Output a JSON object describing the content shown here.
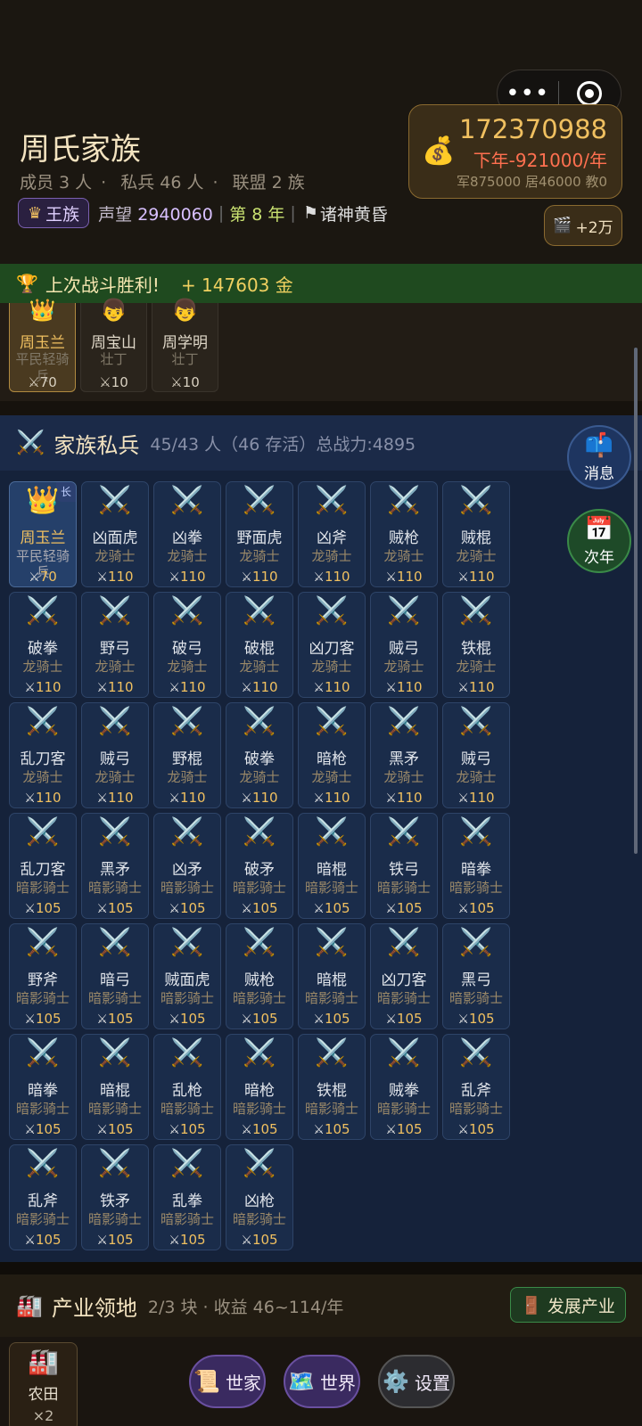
{
  "header": {
    "family_name": "周氏家族",
    "members": "成员 3 人",
    "private_soldiers": "私兵 46 人",
    "alliance": "联盟 2 族",
    "dot": "·",
    "rank_badge": "王族",
    "prestige_label": "声望",
    "prestige_value": "2940060",
    "year": "第 8 年",
    "era": "诸神黄昏"
  },
  "money": {
    "amount": "172370988",
    "income": "下年-921000/年",
    "detail": "军875000 居46000 教0"
  },
  "ad_button": {
    "label": "+2万"
  },
  "victory": {
    "text": "上次战斗胜利!",
    "gold": "+ 147603 金"
  },
  "members": [
    {
      "name": "周玉兰",
      "rank": "平民轻骑兵",
      "power": "70",
      "icon": "crown"
    },
    {
      "name": "周宝山",
      "rank": "壮丁",
      "power": "10",
      "icon": "face"
    },
    {
      "name": "周学明",
      "rank": "壮丁",
      "power": "10",
      "icon": "face"
    }
  ],
  "army": {
    "title": "家族私兵",
    "stats": "45/43 人（46 存活）总战力:4895",
    "leader_badge": "长",
    "soldiers": [
      {
        "name": "周玉兰",
        "rank": "平民轻骑兵",
        "power": "70"
      },
      {
        "name": "凶面虎",
        "rank": "龙骑士",
        "power": "110"
      },
      {
        "name": "凶拳",
        "rank": "龙骑士",
        "power": "110"
      },
      {
        "name": "野面虎",
        "rank": "龙骑士",
        "power": "110"
      },
      {
        "name": "凶斧",
        "rank": "龙骑士",
        "power": "110"
      },
      {
        "name": "贼枪",
        "rank": "龙骑士",
        "power": "110"
      },
      {
        "name": "贼棍",
        "rank": "龙骑士",
        "power": "110"
      },
      {
        "name": "破拳",
        "rank": "龙骑士",
        "power": "110"
      },
      {
        "name": "野弓",
        "rank": "龙骑士",
        "power": "110"
      },
      {
        "name": "破弓",
        "rank": "龙骑士",
        "power": "110"
      },
      {
        "name": "破棍",
        "rank": "龙骑士",
        "power": "110"
      },
      {
        "name": "凶刀客",
        "rank": "龙骑士",
        "power": "110"
      },
      {
        "name": "贼弓",
        "rank": "龙骑士",
        "power": "110"
      },
      {
        "name": "铁棍",
        "rank": "龙骑士",
        "power": "110"
      },
      {
        "name": "乱刀客",
        "rank": "龙骑士",
        "power": "110"
      },
      {
        "name": "贼弓",
        "rank": "龙骑士",
        "power": "110"
      },
      {
        "name": "野棍",
        "rank": "龙骑士",
        "power": "110"
      },
      {
        "name": "破拳",
        "rank": "龙骑士",
        "power": "110"
      },
      {
        "name": "暗枪",
        "rank": "龙骑士",
        "power": "110"
      },
      {
        "name": "黑矛",
        "rank": "龙骑士",
        "power": "110"
      },
      {
        "name": "贼弓",
        "rank": "龙骑士",
        "power": "110"
      },
      {
        "name": "乱刀客",
        "rank": "暗影骑士",
        "power": "105"
      },
      {
        "name": "黑矛",
        "rank": "暗影骑士",
        "power": "105"
      },
      {
        "name": "凶矛",
        "rank": "暗影骑士",
        "power": "105"
      },
      {
        "name": "破矛",
        "rank": "暗影骑士",
        "power": "105"
      },
      {
        "name": "暗棍",
        "rank": "暗影骑士",
        "power": "105"
      },
      {
        "name": "铁弓",
        "rank": "暗影骑士",
        "power": "105"
      },
      {
        "name": "暗拳",
        "rank": "暗影骑士",
        "power": "105"
      },
      {
        "name": "野斧",
        "rank": "暗影骑士",
        "power": "105"
      },
      {
        "name": "暗弓",
        "rank": "暗影骑士",
        "power": "105"
      },
      {
        "name": "贼面虎",
        "rank": "暗影骑士",
        "power": "105"
      },
      {
        "name": "贼枪",
        "rank": "暗影骑士",
        "power": "105"
      },
      {
        "name": "暗棍",
        "rank": "暗影骑士",
        "power": "105"
      },
      {
        "name": "凶刀客",
        "rank": "暗影骑士",
        "power": "105"
      },
      {
        "name": "黑弓",
        "rank": "暗影骑士",
        "power": "105"
      },
      {
        "name": "暗拳",
        "rank": "暗影骑士",
        "power": "105"
      },
      {
        "name": "暗棍",
        "rank": "暗影骑士",
        "power": "105"
      },
      {
        "name": "乱枪",
        "rank": "暗影骑士",
        "power": "105"
      },
      {
        "name": "暗枪",
        "rank": "暗影骑士",
        "power": "105"
      },
      {
        "name": "铁棍",
        "rank": "暗影骑士",
        "power": "105"
      },
      {
        "name": "贼拳",
        "rank": "暗影骑士",
        "power": "105"
      },
      {
        "name": "乱斧",
        "rank": "暗影骑士",
        "power": "105"
      },
      {
        "name": "乱斧",
        "rank": "暗影骑士",
        "power": "105"
      },
      {
        "name": "铁矛",
        "rank": "暗影骑士",
        "power": "105"
      },
      {
        "name": "乱拳",
        "rank": "暗影骑士",
        "power": "105"
      },
      {
        "name": "凶枪",
        "rank": "暗影骑士",
        "power": "105"
      }
    ]
  },
  "side": {
    "messages": "消息",
    "next_year": "次年"
  },
  "industry": {
    "title": "产业领地",
    "stats": "2/3 块 · 收益 46~114/年",
    "develop_button": "发展产业",
    "farm_name": "农田",
    "farm_count": "×2"
  },
  "nav": {
    "family": "世家",
    "world": "世界",
    "settings": "设置"
  },
  "colors": {
    "gold": "#f0c060",
    "victory_bg": "#1f4a1f",
    "army_bg": "#15223a"
  },
  "icons": {
    "soldier": "crossed-swords-icon",
    "leader": "crown-icon",
    "member": "face-icon"
  }
}
